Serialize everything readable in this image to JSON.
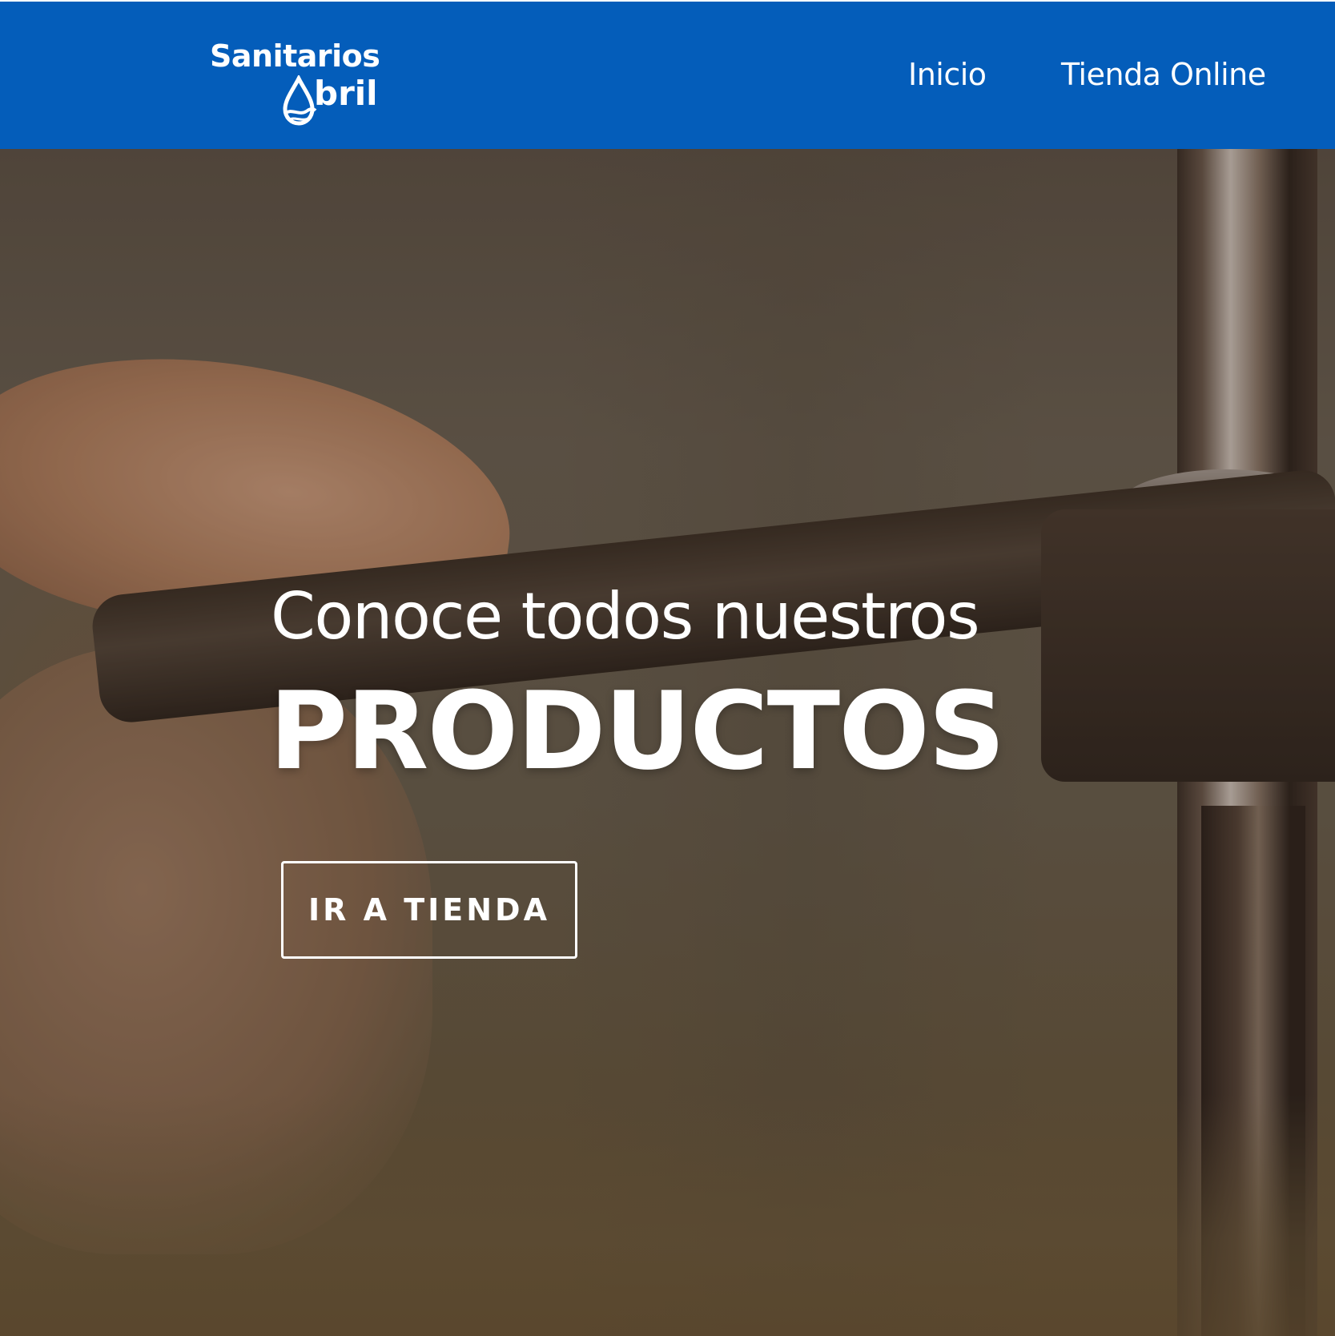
{
  "header": {
    "background_color": "#045dba",
    "logo": {
      "line1": "Sanitarios",
      "line2": "bril",
      "icon": "water-drop-icon"
    },
    "nav": {
      "items": [
        {
          "label": "Inicio"
        },
        {
          "label": "Tienda Online"
        }
      ]
    }
  },
  "hero": {
    "subtitle": "Conoce todos nuestros",
    "title": "PRODUCTOS",
    "cta_label": "IR A TIENDA"
  }
}
